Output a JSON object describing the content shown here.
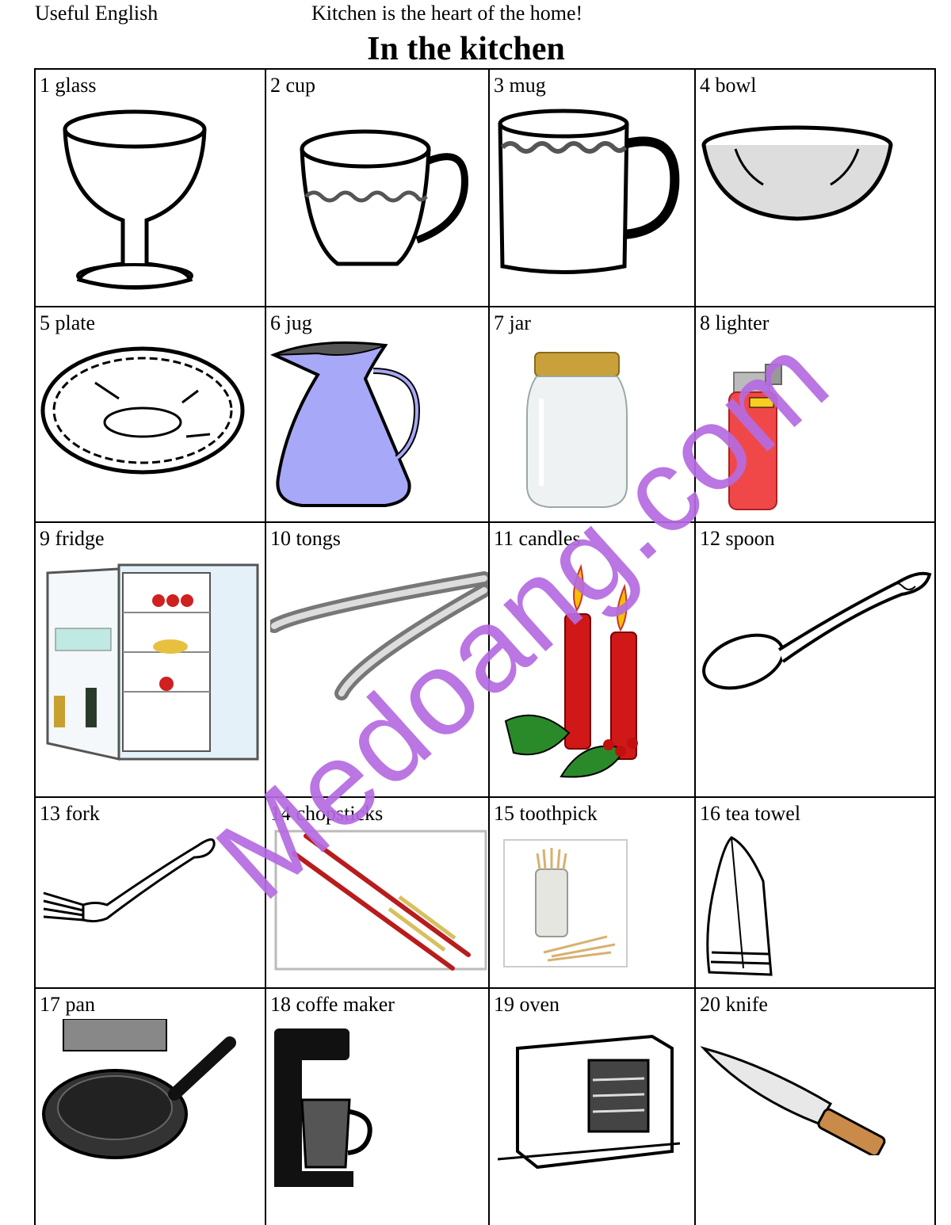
{
  "header": {
    "left": "Useful English",
    "center": "Kitchen is the heart of the home!",
    "title": "In the kitchen"
  },
  "items": [
    {
      "label": "1 glass",
      "icon": "glass-icon"
    },
    {
      "label": "2 cup",
      "icon": "cup-icon"
    },
    {
      "label": "3 mug",
      "icon": "mug-icon"
    },
    {
      "label": "4 bowl",
      "icon": "bowl-icon"
    },
    {
      "label": "5 plate",
      "icon": "plate-icon"
    },
    {
      "label": "6 jug",
      "icon": "jug-icon"
    },
    {
      "label": "7 jar",
      "icon": "jar-icon"
    },
    {
      "label": "8 lighter",
      "icon": "lighter-icon"
    },
    {
      "label": "9 fridge",
      "icon": "fridge-icon"
    },
    {
      "label": "10 tongs",
      "icon": "tongs-icon"
    },
    {
      "label": "11 candles",
      "icon": "candles-icon"
    },
    {
      "label": "12 spoon",
      "icon": "spoon-icon"
    },
    {
      "label": "13 fork",
      "icon": "fork-icon"
    },
    {
      "label": "14 chopsticks",
      "icon": "chopsticks-icon"
    },
    {
      "label": "15 toothpick",
      "icon": "toothpick-icon"
    },
    {
      "label": "16 tea towel",
      "icon": "tea-towel-icon"
    },
    {
      "label": "17 pan",
      "icon": "pan-icon"
    },
    {
      "label": "18 coffe maker",
      "icon": "coffee-maker-icon"
    },
    {
      "label": "19 oven",
      "icon": "oven-icon"
    },
    {
      "label": "20 knife",
      "icon": "knife-icon"
    }
  ],
  "watermark": "Medoang.com",
  "colors": {
    "watermark": "#b56be0",
    "jug": "#a8a8f8",
    "lighter": "#f04848",
    "candle": "#d01818",
    "holly": "#2a8a2a",
    "chopsticks": "#b81c1c",
    "jar_lid": "#c9a13a",
    "knife_handle": "#c98a4a"
  }
}
